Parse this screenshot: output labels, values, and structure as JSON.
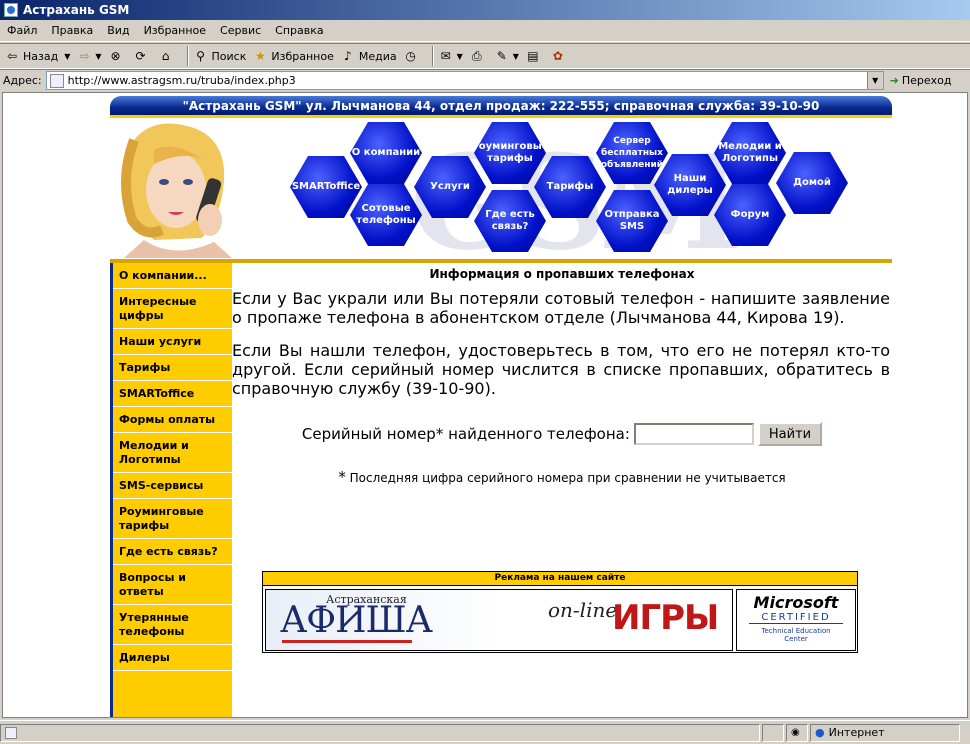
{
  "window": {
    "title": "Астрахань GSM"
  },
  "menu": [
    "Файл",
    "Правка",
    "Вид",
    "Избранное",
    "Сервис",
    "Справка"
  ],
  "toolbar": {
    "back": "Назад",
    "search": "Поиск",
    "favorites": "Избранное",
    "media": "Медиа"
  },
  "address": {
    "label": "Адрес:",
    "url": "http://www.astragsm.ru/truba/index.php3",
    "go": "Переход"
  },
  "banner": {
    "text": "\"Астрахань GSM\" ул. Лычманова 44, отдел продаж: 222-555; справочная служба: 39-10-90"
  },
  "header": {
    "watermark": "GSM",
    "nav": [
      "SMARToffice",
      "О компании",
      "Сотовые телефоны",
      "Услуги",
      "Роуминговые тарифы",
      "Где есть связь?",
      "Тарифы",
      "Сервер бесплатных объявлений",
      "Отправка SMS",
      "Наши дилеры",
      "Мелодии и Логотипы",
      "Форум",
      "Домой"
    ]
  },
  "sidebar": {
    "items": [
      "О компании...",
      "Интересные цифры",
      "Наши услуги",
      "Тарифы",
      "SMARToffice",
      "Формы оплаты",
      "Мелодии и Логотипы",
      "SMS-сервисы",
      "Роуминговые тарифы",
      "Где есть связь?",
      "Вопросы и ответы",
      "Утерянные телефоны",
      "Дилеры"
    ]
  },
  "content": {
    "title": "Информация о пропавших телефонах",
    "para1": "Если у Вас украли или Вы потеряли сотовый телефон - напишите заявление о пропаже телефона в абонентском отделе (Лычманова 44, Кирова 19).",
    "para2": "Если Вы нашли телефон, удостоверьтесь в том, что его не потерял кто-то другой. Если серийный номер числится в списке пропавших, обратитесь в справочную службу (39-10-90).",
    "search_label": "Серийный номер* найденного телефона:",
    "search_value": "",
    "search_button": "Найти",
    "note_star": "*",
    "note": "Последняя цифра серийного номера при сравнении не учитывается"
  },
  "ads": {
    "heading": "Реклама на нашем сайте",
    "afisha_small": "Астраханская",
    "afisha_big": "АФИША",
    "online": "on-line",
    "games": "ИГРЫ",
    "ms_brand": "Microsoft",
    "ms_certified": "CERTIFIED",
    "ms_sub1": "Technical Education",
    "ms_sub2": "Center"
  },
  "status": {
    "zone": "Интернет"
  }
}
